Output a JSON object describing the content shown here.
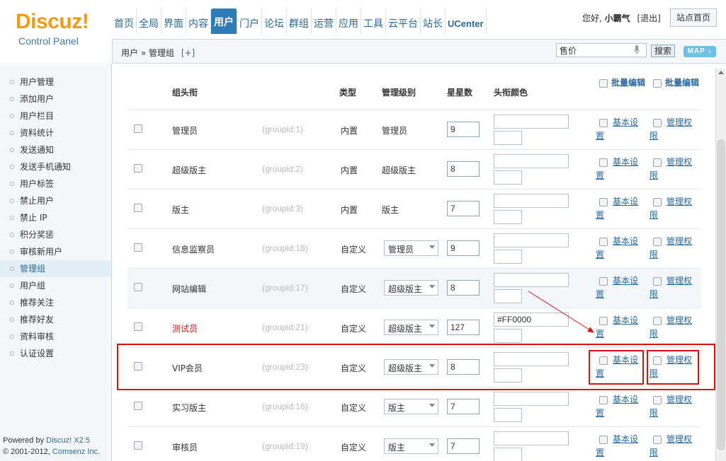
{
  "logo": {
    "brand": "Discuz!",
    "sub": "Control Panel"
  },
  "topnav": [
    {
      "label": "首页",
      "active": false
    },
    {
      "label": "全局",
      "active": false
    },
    {
      "label": "界面",
      "active": false
    },
    {
      "label": "内容",
      "active": false
    },
    {
      "label": "用户",
      "active": true
    },
    {
      "label": "门户",
      "active": false
    },
    {
      "label": "论坛",
      "active": false
    },
    {
      "label": "群组",
      "active": false
    },
    {
      "label": "运营",
      "active": false
    },
    {
      "label": "应用",
      "active": false
    },
    {
      "label": "工具",
      "active": false
    },
    {
      "label": "云平台",
      "active": false
    },
    {
      "label": "站长",
      "active": false
    },
    {
      "label": "UCenter",
      "active": false
    }
  ],
  "userbar": {
    "greeting": "您好,",
    "username": "小霸气",
    "logout": "[退出]",
    "home": "站点首页"
  },
  "subbar": {
    "breadcrumb": "用户 » 管理组",
    "add": "[+]",
    "search_value": "售价",
    "search_button": "搜索",
    "map_button": "MAP"
  },
  "sidebar": {
    "items": [
      "用户管理",
      "添加用户",
      "用户栏目",
      "资料统计",
      "发送通知",
      "发送手机通知",
      "用户标签",
      "禁止用户",
      "禁止 IP",
      "积分奖惩",
      "审核新用户",
      "管理组",
      "用户组",
      "推荐关注",
      "推荐好友",
      "资料审核",
      "认证设置"
    ],
    "active_index": 11
  },
  "powered": {
    "line1_prefix": "Powered by ",
    "line1_brand": "Discuz! X2.5",
    "line2_prefix": "© 2001-2012, ",
    "line2_brand": "Comsenz Inc."
  },
  "table": {
    "headers": {
      "title": "组头衔",
      "type": "类型",
      "level": "管理级别",
      "stars": "星星数",
      "color": "头衔颜色",
      "bulk1": "批量编辑",
      "bulk2": "批量编辑"
    },
    "link_basic": "基本设置",
    "link_perm": "管理权限",
    "rows": [
      {
        "name": "管理员",
        "gid": "(groupid:1)",
        "type": "内置",
        "level": "管理员",
        "level_select": false,
        "stars": "9",
        "color": "",
        "red": false
      },
      {
        "name": "超级版主",
        "gid": "(groupid:2)",
        "type": "内置",
        "level": "超级版主",
        "level_select": false,
        "stars": "8",
        "color": "",
        "red": false
      },
      {
        "name": "版主",
        "gid": "(groupid:3)",
        "type": "内置",
        "level": "版主",
        "level_select": false,
        "stars": "7",
        "color": "",
        "red": false
      },
      {
        "name": "信息监察员",
        "gid": "(groupid:18)",
        "type": "自定义",
        "level": "管理员",
        "level_select": true,
        "stars": "9",
        "color": "",
        "red": false
      },
      {
        "name": "网站编辑",
        "gid": "(groupid:17)",
        "type": "自定义",
        "level": "超级版主",
        "level_select": true,
        "stars": "8",
        "color": "",
        "red": false
      },
      {
        "name": "测试员",
        "gid": "(groupid:21)",
        "type": "自定义",
        "level": "超级版主",
        "level_select": true,
        "stars": "127",
        "color": "#FF0000",
        "red": true
      },
      {
        "name": "VIP会员",
        "gid": "(groupid:23)",
        "type": "自定义",
        "level": "超级版主",
        "level_select": true,
        "stars": "8",
        "color": "",
        "red": false
      },
      {
        "name": "实习版主",
        "gid": "(groupid:16)",
        "type": "自定义",
        "level": "版主",
        "level_select": true,
        "stars": "7",
        "color": "",
        "red": false
      },
      {
        "name": "审核员",
        "gid": "(groupid:19)",
        "type": "自定义",
        "level": "版主",
        "level_select": true,
        "stars": "7",
        "color": "",
        "red": false
      }
    ]
  },
  "colors": {
    "accent": "#2d7bb7",
    "link": "#2b6aa3",
    "logo": "#f39c12",
    "annotation": "#e01010"
  }
}
